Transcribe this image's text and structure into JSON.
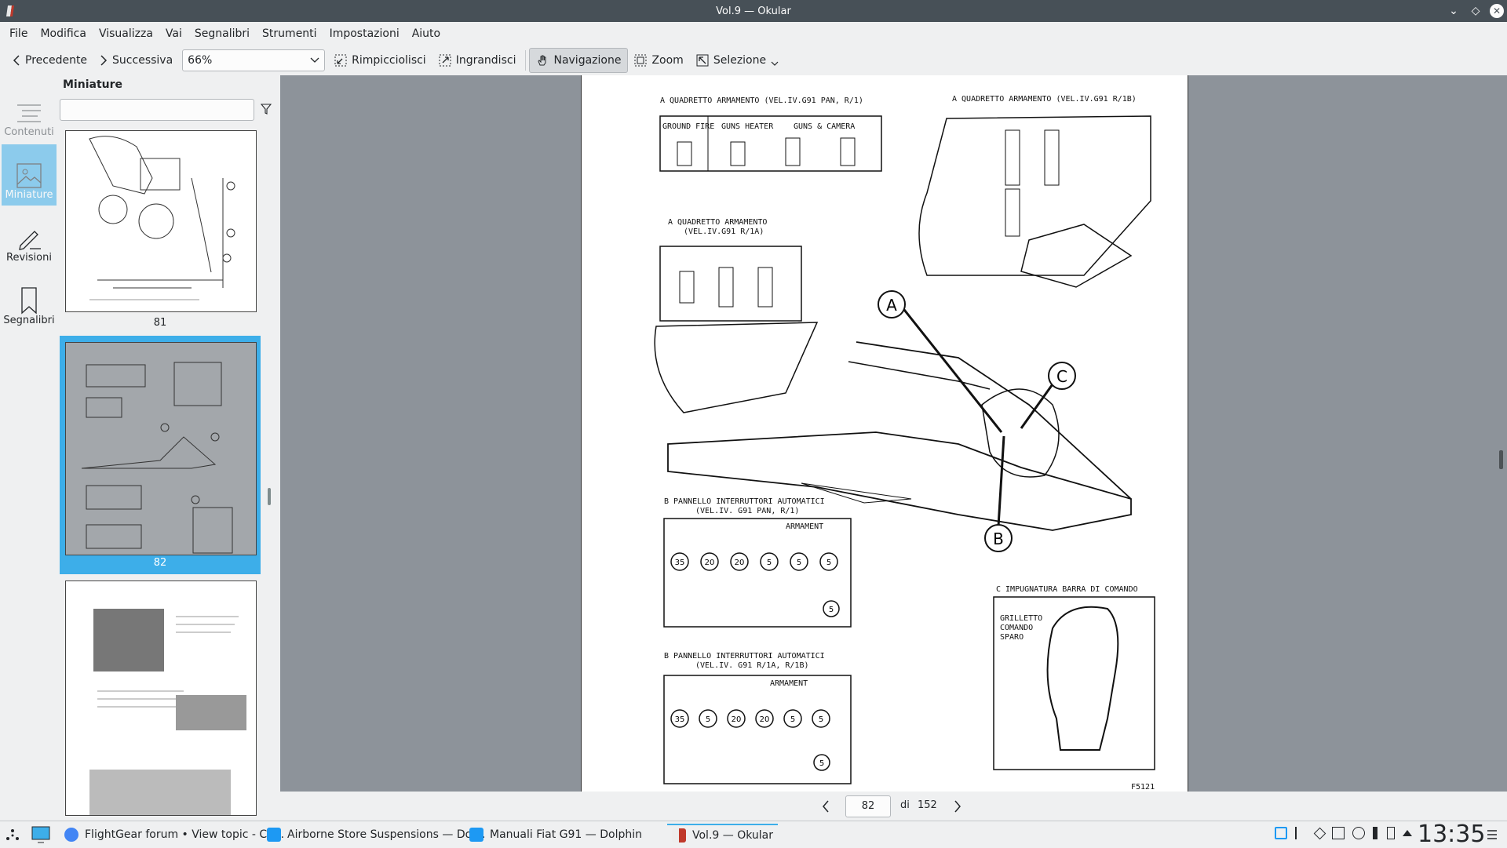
{
  "window": {
    "title": "Vol.9 — Okular"
  },
  "menu": [
    "File",
    "Modifica",
    "Visualizza",
    "Vai",
    "Segnalibri",
    "Strumenti",
    "Impostazioni",
    "Aiuto"
  ],
  "toolbar": {
    "prev": "Precedente",
    "next": "Successiva",
    "zoom_value": "66%",
    "zoom_out": "Rimpicciolisci",
    "zoom_in": "Ingrandisci",
    "navigation": "Navigazione",
    "zoom": "Zoom",
    "selection": "Selezione"
  },
  "side_tabs": [
    "Contenuti",
    "Miniature",
    "Revisioni",
    "Segnalibri"
  ],
  "thumbnails_panel": {
    "title": "Miniature",
    "search_placeholder": ""
  },
  "thumbnails": [
    {
      "number": "81"
    },
    {
      "number": "82",
      "selected": true
    },
    {
      "number": ""
    }
  ],
  "page_labels": {
    "a1": "A   QUADRETTO ARMAMENTO (VEL.IV.G91 PAN, R/1)",
    "a2": "A   QUADRETTO ARMAMENTO (VEL.IV.G91 R/1B)",
    "a3": "A   QUADRETTO ARMAMENTO",
    "a3b": "(VEL.IV.G91 R/1A)",
    "ground_fire": "GROUND FIRE",
    "guns_heater": "GUNS HEATER",
    "guns_camera": "GUNS & CAMERA",
    "b1": "B   PANNELLO INTERRUTTORI AUTOMATICI",
    "b1b": "(VEL.IV. G91 PAN, R/1)",
    "b2": "B   PANNELLO INTERRUTTORI AUTOMATICI",
    "b2b": "(VEL.IV. G91 R/1A, R/1B)",
    "armament": "ARMAMENT",
    "c1": "C   IMPUGNATURA BARRA DI COMANDO",
    "grilletto": "GRILLETTO",
    "comando": "COMANDO",
    "sparo": "SPARO",
    "callout_a": "A",
    "callout_b": "B",
    "callout_c": "C",
    "figure_id": "F5121"
  },
  "breakers_b1": [
    "35",
    "20",
    "20",
    "5",
    "5",
    "5"
  ],
  "breakers_b2": [
    "35",
    "5",
    "20",
    "20",
    "5",
    "5"
  ],
  "breaker_gear_b1": "5",
  "breaker_gear_b2": "5",
  "pagination": {
    "current": "82",
    "of_label": "di",
    "total": "152"
  },
  "taskbar": {
    "tasks": [
      "FlightGear forum • View topic - Ca...",
      "Airborne Store Suspensions — Dol...",
      "Manuali Fiat G91 — Dolphin",
      "Vol.9 — Okular"
    ],
    "clock": "13:35"
  },
  "colors": {
    "titlebar": "#475057",
    "accent": "#3daee9",
    "viewer_bg": "#8d939a"
  }
}
